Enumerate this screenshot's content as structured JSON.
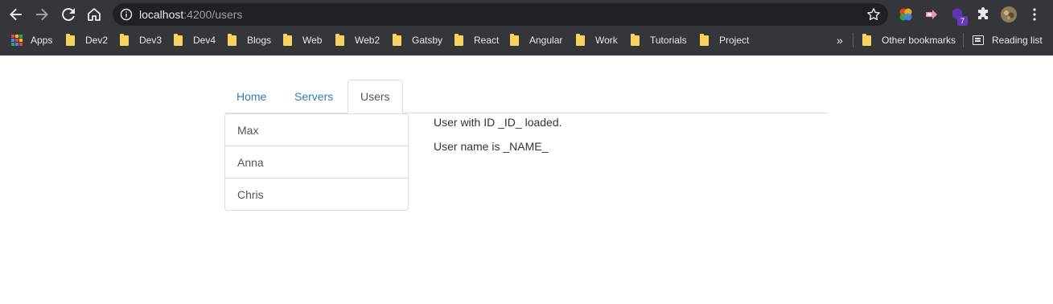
{
  "browser": {
    "url_host": "localhost",
    "url_path": ":4200/users",
    "extension_badge": "7",
    "bookmarks": {
      "apps_label": "Apps",
      "items": [
        "Dev2",
        "Dev3",
        "Dev4",
        "Blogs",
        "Web",
        "Web2",
        "Gatsby",
        "React",
        "Angular",
        "Work",
        "Tutorials",
        "Project"
      ],
      "overflow_label": "»",
      "other_label": "Other bookmarks",
      "reading_label": "Reading list"
    },
    "colors": {
      "chrome_bg": "#35363a",
      "omnibox_bg": "#202124",
      "folder": "#f4d35e"
    }
  },
  "page": {
    "tabs": [
      {
        "label": "Home",
        "active": false
      },
      {
        "label": "Servers",
        "active": false
      },
      {
        "label": "Users",
        "active": true
      }
    ],
    "users": [
      "Max",
      "Anna",
      "Chris"
    ],
    "detail": {
      "line1": "User with ID _ID_ loaded.",
      "line2": "User name is _NAME_"
    },
    "colors": {
      "link": "#337ab7",
      "border": "#dddddd",
      "text": "#333333"
    }
  }
}
